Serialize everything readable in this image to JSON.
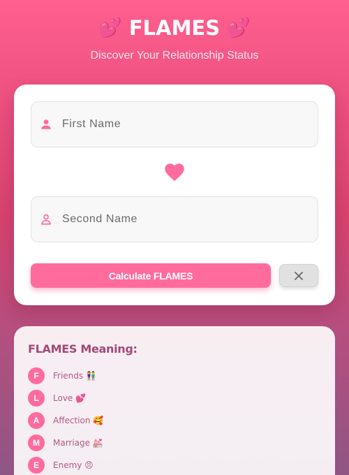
{
  "header": {
    "emoji_left": "💕",
    "title": "FLAMES",
    "emoji_right": "💕",
    "subtitle": "Discover Your Relationship Status"
  },
  "form": {
    "first_name_placeholder": "First Name",
    "second_name_placeholder": "Second Name",
    "first_name_value": "",
    "second_name_value": "",
    "calculate_label": "Calculate FLAMES",
    "clear_icon": "close-icon",
    "person_icon": "person-icon",
    "heart_icon": "heart-icon"
  },
  "meaning": {
    "title": "FLAMES Meaning:",
    "items": [
      {
        "letter": "F",
        "text": "Friends 👫"
      },
      {
        "letter": "L",
        "text": "Love 💕"
      },
      {
        "letter": "A",
        "text": "Affection 🥰"
      },
      {
        "letter": "M",
        "text": "Marriage 💒"
      },
      {
        "letter": "E",
        "text": "Enemy 😠"
      }
    ]
  },
  "colors": {
    "accent": "#ff6b9c",
    "background_top": "#ff5f8f",
    "background_bottom": "#8f5684",
    "meaning_text": "#b05a85"
  }
}
